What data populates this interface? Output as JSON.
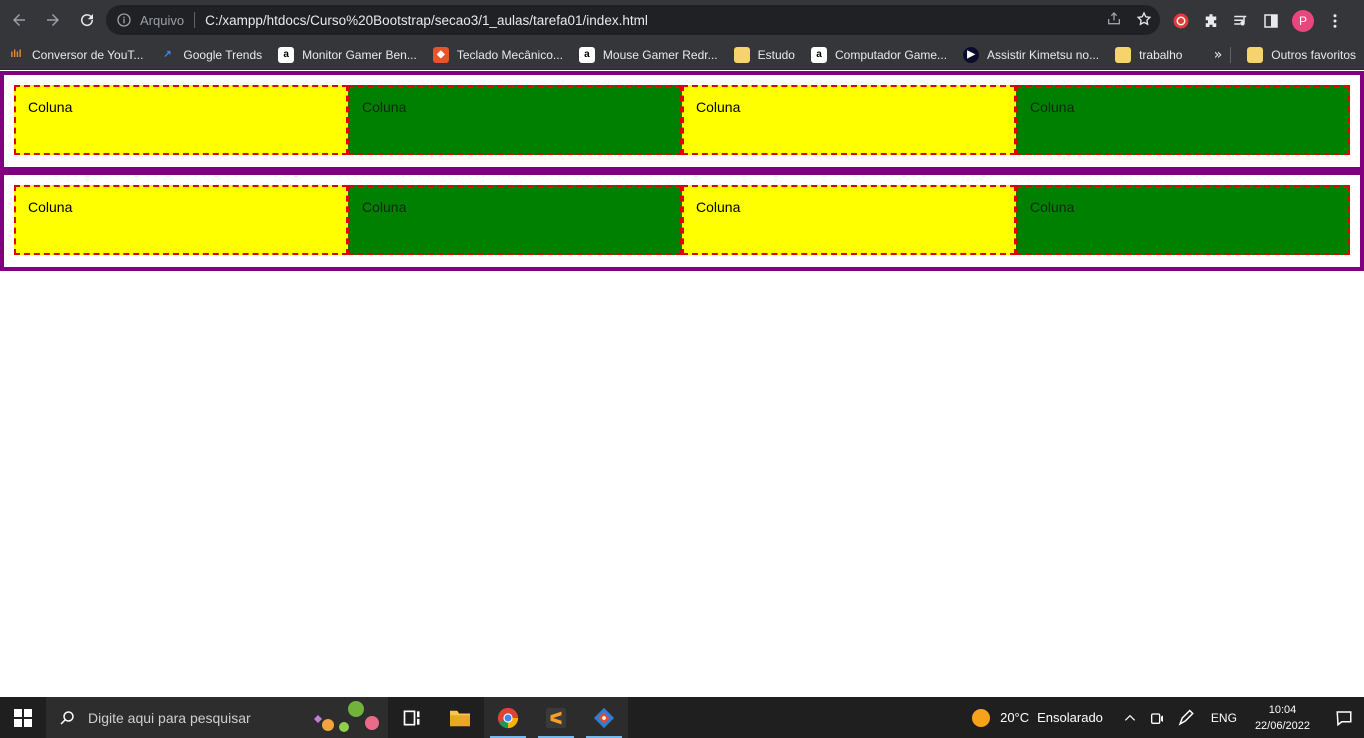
{
  "browser": {
    "scheme_label": "Arquivo",
    "url": "C:/xampp/htdocs/Curso%20Bootstrap/secao3/1_aulas/tarefa01/index.html",
    "profile_initial": "P"
  },
  "bookmarks": [
    {
      "label": "Conversor de YouT...",
      "icon": "waveform-icon",
      "color": "#f28b30"
    },
    {
      "label": "Google Trends",
      "icon": "trends-icon",
      "color": "#4285f4"
    },
    {
      "label": "Monitor Gamer Ben...",
      "icon": "amazon-icon",
      "color": "#ffffff"
    },
    {
      "label": "Teclado Mecânico...",
      "icon": "shop-icon",
      "color": "#e8552b"
    },
    {
      "label": "Mouse Gamer Redr...",
      "icon": "amazon-icon",
      "color": "#ffffff"
    },
    {
      "label": "Estudo",
      "icon": "folder-icon",
      "color": "#f6d36b"
    },
    {
      "label": "Computador Game...",
      "icon": "amazon-icon",
      "color": "#ffffff"
    },
    {
      "label": "Assistir Kimetsu no...",
      "icon": "play-icon",
      "color": "#0b0b2b"
    },
    {
      "label": "trabalho",
      "icon": "folder-icon",
      "color": "#f6d36b"
    }
  ],
  "bookmarks_more": "»",
  "other_bookmarks": "Outros favoritos",
  "rows": [
    {
      "columns": [
        "Coluna",
        "Coluna",
        "Coluna",
        "Coluna"
      ]
    },
    {
      "columns": [
        "Coluna",
        "Coluna",
        "Coluna",
        "Coluna"
      ]
    }
  ],
  "colors": {
    "row_border": "#800080",
    "col_yellow": "#ffff00",
    "col_green": "#008000",
    "col_border": "#e00000"
  },
  "taskbar": {
    "search_placeholder": "Digite aqui para pesquisar",
    "weather_temp": "20°C",
    "weather_text": "Ensolarado",
    "language": "ENG",
    "time": "10:04",
    "date": "22/06/2022"
  }
}
